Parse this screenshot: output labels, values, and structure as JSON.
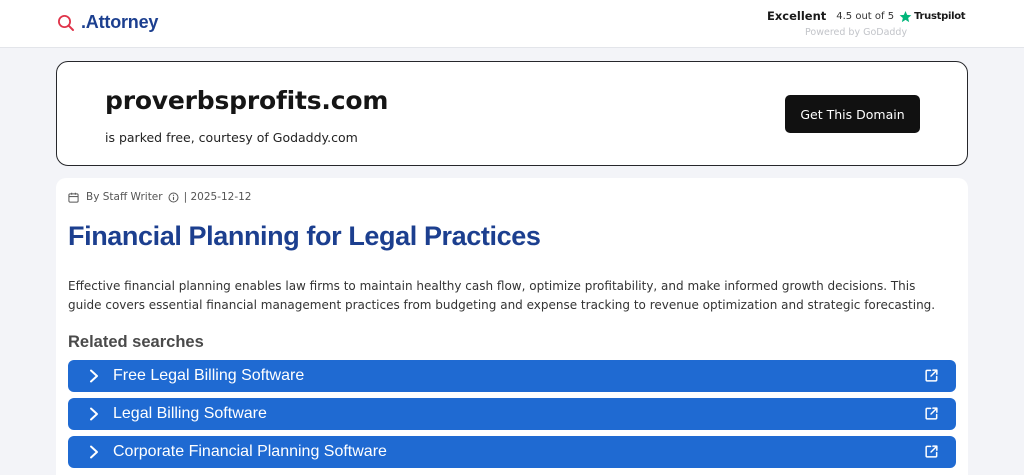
{
  "header": {
    "logo_text": ".Attorney",
    "logo_icon": "search-icon",
    "rating_label": "Excellent",
    "rating_score": "4.5 out of 5",
    "trustpilot_icon": "star-icon",
    "trustpilot_name": "Trustpilot",
    "powered_by": "Powered by GoDaddy"
  },
  "domain_banner": {
    "domain_name": "proverbsprofits.com",
    "subtitle": "is parked free, courtesy of Godaddy.com",
    "cta_label": "Get This Domain"
  },
  "article": {
    "author": "By Staff Writer",
    "date": "| 2025-12-12",
    "title": "Financial Planning for Legal Practices",
    "description": "Effective financial planning enables law firms to maintain healthy cash flow, optimize profitability, and make informed growth decisions. This guide covers essential financial management practices from budgeting and expense tracking to revenue optimization and strategic forecasting."
  },
  "related": {
    "heading": "Related searches",
    "items": [
      {
        "label": "Free Legal Billing Software"
      },
      {
        "label": "Legal Billing Software"
      },
      {
        "label": "Corporate Financial Planning Software"
      }
    ]
  },
  "colors": {
    "brand_blue": "#1c3f8f",
    "related_blue": "#1f6ad2",
    "trustpilot_green": "#00b67a",
    "logo_red": "#e0344a",
    "cta_black": "#111111"
  }
}
